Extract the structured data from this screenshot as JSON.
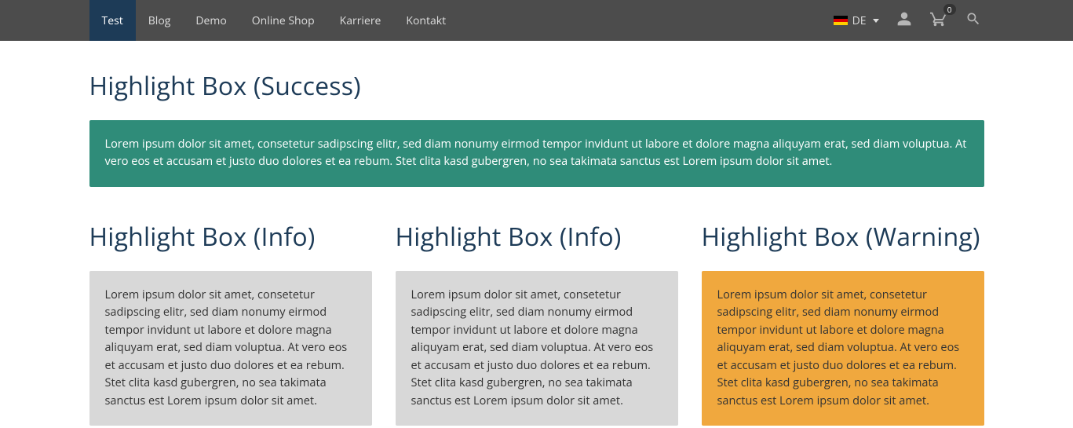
{
  "nav": {
    "items": [
      {
        "label": "Test",
        "active": true
      },
      {
        "label": "Blog",
        "active": false
      },
      {
        "label": "Demo",
        "active": false
      },
      {
        "label": "Online Shop",
        "active": false
      },
      {
        "label": "Karriere",
        "active": false
      },
      {
        "label": "Kontakt",
        "active": false
      }
    ],
    "lang_code": "DE",
    "cart_count": "0"
  },
  "success": {
    "heading": "Highlight Box (Success)",
    "body": "Lorem ipsum dolor sit amet, consetetur sadipscing elitr, sed diam nonumy eirmod tempor invidunt ut labore et dolore magna aliquyam erat, sed diam voluptua. At vero eos et accusam et justo duo dolores et ea rebum. Stet clita kasd gubergren, no sea takimata sanctus est Lorem ipsum dolor sit amet."
  },
  "cols": [
    {
      "heading": "Highlight Box (Info)",
      "variant": "info",
      "body": "Lorem ipsum dolor sit amet, consetetur sadipscing elitr, sed diam nonumy eirmod tempor invidunt ut labore et dolore magna aliquyam erat, sed diam voluptua. At vero eos et accusam et justo duo dolores et ea rebum. Stet clita kasd gubergren, no sea takimata sanctus est Lorem ipsum dolor sit amet."
    },
    {
      "heading": "Highlight Box (Info)",
      "variant": "info",
      "body": "Lorem ipsum dolor sit amet, consetetur sadipscing elitr, sed diam nonumy eirmod tempor invidunt ut labore et dolore magna aliquyam erat, sed diam voluptua. At vero eos et accusam et justo duo dolores et ea rebum. Stet clita kasd gubergren, no sea takimata sanctus est Lorem ipsum dolor sit amet."
    },
    {
      "heading": "Highlight Box (Warning)",
      "variant": "warning",
      "body": "Lorem ipsum dolor sit amet, consetetur sadipscing elitr, sed diam nonumy eirmod tempor invidunt ut labore et dolore magna aliquyam erat, sed diam voluptua. At vero eos et accusam et justo duo dolores et ea rebum. Stet clita kasd gubergren, no sea takimata sanctus est Lorem ipsum dolor sit amet."
    }
  ],
  "colors": {
    "accent": "#1d3b57",
    "success": "#2f8c79",
    "info": "#d8d8d8",
    "warning": "#f0a83e"
  }
}
